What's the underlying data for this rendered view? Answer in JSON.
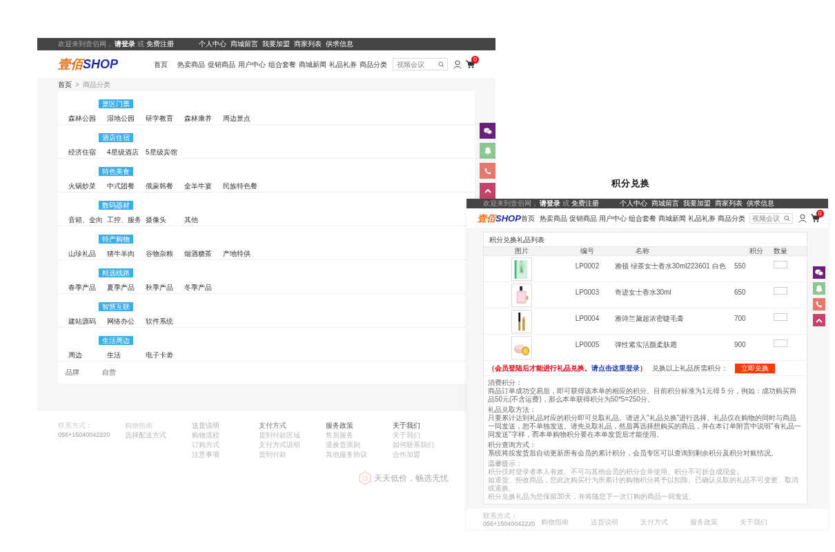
{
  "caption": "积分兑换",
  "category_page": {
    "top_bar": {
      "greeting": "欢迎来到壹佰网，",
      "login": "请登录",
      "or": "或",
      "register": "免费注册",
      "links": [
        "个人中心",
        "商城留言",
        "我要加盟",
        "商家列表",
        "供求信息"
      ]
    },
    "logo": {
      "cn": "壹佰",
      "en": "SHOP"
    },
    "nav": [
      "首页",
      "热卖商品",
      "促销商品",
      "用户中心",
      "组合套餐",
      "商城新闻",
      "礼品礼券",
      "商品分类"
    ],
    "search": {
      "placeholder": "视频会议"
    },
    "cart_count": "0",
    "breadcrumb": {
      "home": "首页",
      "separator": ">",
      "current": "商品分类"
    },
    "categories": [
      {
        "badge": "景区门票",
        "items": [
          "森林公园",
          "湿地公园",
          "研学教育",
          "森林康养",
          "周边景点"
        ]
      },
      {
        "badge": "酒店住宿",
        "items": [
          "经济住宿",
          "4星级酒店",
          "5星级宾馆"
        ]
      },
      {
        "badge": "特色美食",
        "items": [
          "火锅炒菜",
          "中式团餐",
          "俄蒙韩餐",
          "全羊牛宴",
          "民族特色餐"
        ]
      },
      {
        "badge": "数码器材",
        "items": [
          "音箱、全向",
          "工控、服务",
          "摄像头",
          "其他"
        ]
      },
      {
        "badge": "特产购物",
        "items": [
          "山珍礼品",
          "猪牛羊肉",
          "谷物杂粮",
          "烟酒糖茶",
          "产地特供"
        ]
      },
      {
        "badge": "精选线路",
        "items": [
          "春季产品",
          "夏季产品",
          "秋季产品",
          "冬季产品"
        ]
      },
      {
        "badge": "智慧互联",
        "items": [
          "建站源码",
          "网络办公",
          "软件系统"
        ]
      },
      {
        "badge": "生活周边",
        "items": [
          "周边",
          "生活",
          "电子卡劵"
        ]
      }
    ],
    "brand_row": {
      "label": "品牌",
      "items": [
        "自营"
      ]
    },
    "footer": {
      "contact": {
        "label": "联系方式：",
        "phone": "056+15040042220"
      },
      "columns": [
        {
          "title": "购物指南",
          "links": [
            "选择配送方式"
          ]
        },
        {
          "title": "送货说明",
          "links": [
            "购物流程",
            "订购方式",
            "注意事项"
          ]
        },
        {
          "title": "支付方式",
          "links": [
            "货到付款区域",
            "支付方式说明",
            "货到付款"
          ]
        },
        {
          "title": "服务政策",
          "links": [
            "售后服务",
            "退换货原则",
            "其他服务协议"
          ]
        },
        {
          "title": "关于我们",
          "links": [
            "关于我们",
            "如何联系我们",
            "合作加盟"
          ]
        }
      ],
      "slogan": "天天低价，畅选无忧"
    }
  },
  "exchange_page": {
    "top_bar": {
      "greeting": "欢迎来到壹佰网，",
      "login": "请登录",
      "or": "或",
      "register": "免费注册",
      "links": [
        "个人中心",
        "商城留言",
        "我要加盟",
        "商家列表",
        "供求信息"
      ]
    },
    "logo": {
      "cn": "壹佰",
      "en": "SHOP"
    },
    "nav": [
      "首页",
      "热卖商品",
      "促销商品",
      "用户中心",
      "组合套餐",
      "商城新闻",
      "礼品礼券",
      "商品分类"
    ],
    "search": {
      "placeholder": "视频会议"
    },
    "cart_count": "0",
    "table": {
      "title": "积分兑换礼品列表",
      "columns": [
        "图片",
        "编号",
        "名称",
        "积分",
        "数量"
      ],
      "rows": [
        {
          "code": "LP0002",
          "name": "雅顿 绿茶女士香水30ml223601 白色",
          "points": "550"
        },
        {
          "code": "LP0003",
          "name": "奇迹女士香水30ml",
          "points": "650"
        },
        {
          "code": "LP0004",
          "name": "雅诗兰黛超浓密睫毛膏",
          "points": "700"
        },
        {
          "code": "LP0005",
          "name": "弹性紧实活颜柔肤霜",
          "points": "900"
        }
      ]
    },
    "notice": {
      "open": "（会员登陆后才能进行礼品兑换。",
      "link": "请点击这里登录",
      "close": "）"
    },
    "points_label": "兑换以上礼品所需积分：",
    "button": "立即兑换",
    "terms": [
      {
        "heading": "消费积分：",
        "lines": [
          "商品订单成功交易后，即可获得该本单的相应的积分。目前积分标准为1元得 5 分，例如：成功购买商品50元(不含运费)，那么本单获得积分为50*5=250分。"
        ]
      },
      {
        "heading": "礼品兑取方法：",
        "lines": [
          "只要累计达到礼品对应的积分即可兑取礼品。请进入\"礼品兑换\"进行选择。礼品仅在购物的同时与商品一同发送，恕不单独发送。请先兑取礼品，然后再选择想购买的商品，并在本订单附言中说明\"有礼品一同发送\"字样，而本单购物积分要在本单发货后才能使用。"
        ]
      },
      {
        "heading": "积分查询方式：",
        "lines": [
          "系统将按发货后自动更新所有会员的累计积分，会员专区可以查询到剩余积分及积分对账情况。"
        ]
      },
      {
        "heading": "温馨提示：",
        "lines": [
          "积分仅对登录者本人有效。不可与其他会员的积分合并使用。积分不可折合成现金。",
          "如退货、拒收商品，您此次购买行为所累计的购物积分将予以扣除。已确认兑取的礼品不可变更、取消或退换。",
          "积分兑换礼品为您保留30天，并将随您下一次订购的商品一同发送。"
        ]
      }
    ],
    "footer": {
      "contact": {
        "label": "联系方式：",
        "phone": "056+15040042220"
      },
      "columns": [
        {
          "title": "购物指南"
        },
        {
          "title": "送货说明"
        },
        {
          "title": "支付方式"
        },
        {
          "title": "服务政策"
        },
        {
          "title": "关于我们"
        }
      ]
    }
  }
}
